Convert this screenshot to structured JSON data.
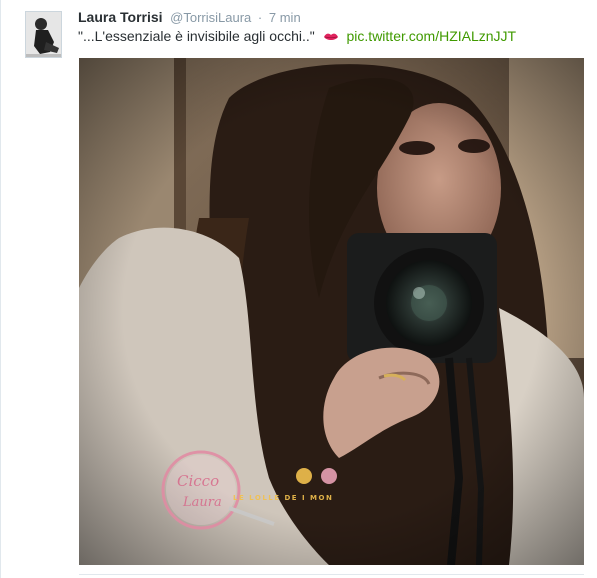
{
  "tweet": {
    "author_name": "Laura Torrisi",
    "author_handle": "@TorrisiLaura",
    "separator": "·",
    "timestamp": "7 min",
    "text": "\"...L'essenziale è invisibile agli occhi..\"",
    "emoji": "kiss-lips-icon",
    "link": "pic.twitter.com/HZIALznJJT"
  },
  "watermark": {
    "logo_text_1": "Cicco",
    "logo_text_2": "Laura",
    "banner_text": "LE LOLLE DE I MON"
  },
  "colors": {
    "name": "#292f33",
    "meta": "#8899a6",
    "link": "#409a00",
    "kiss": "#e0245e"
  }
}
